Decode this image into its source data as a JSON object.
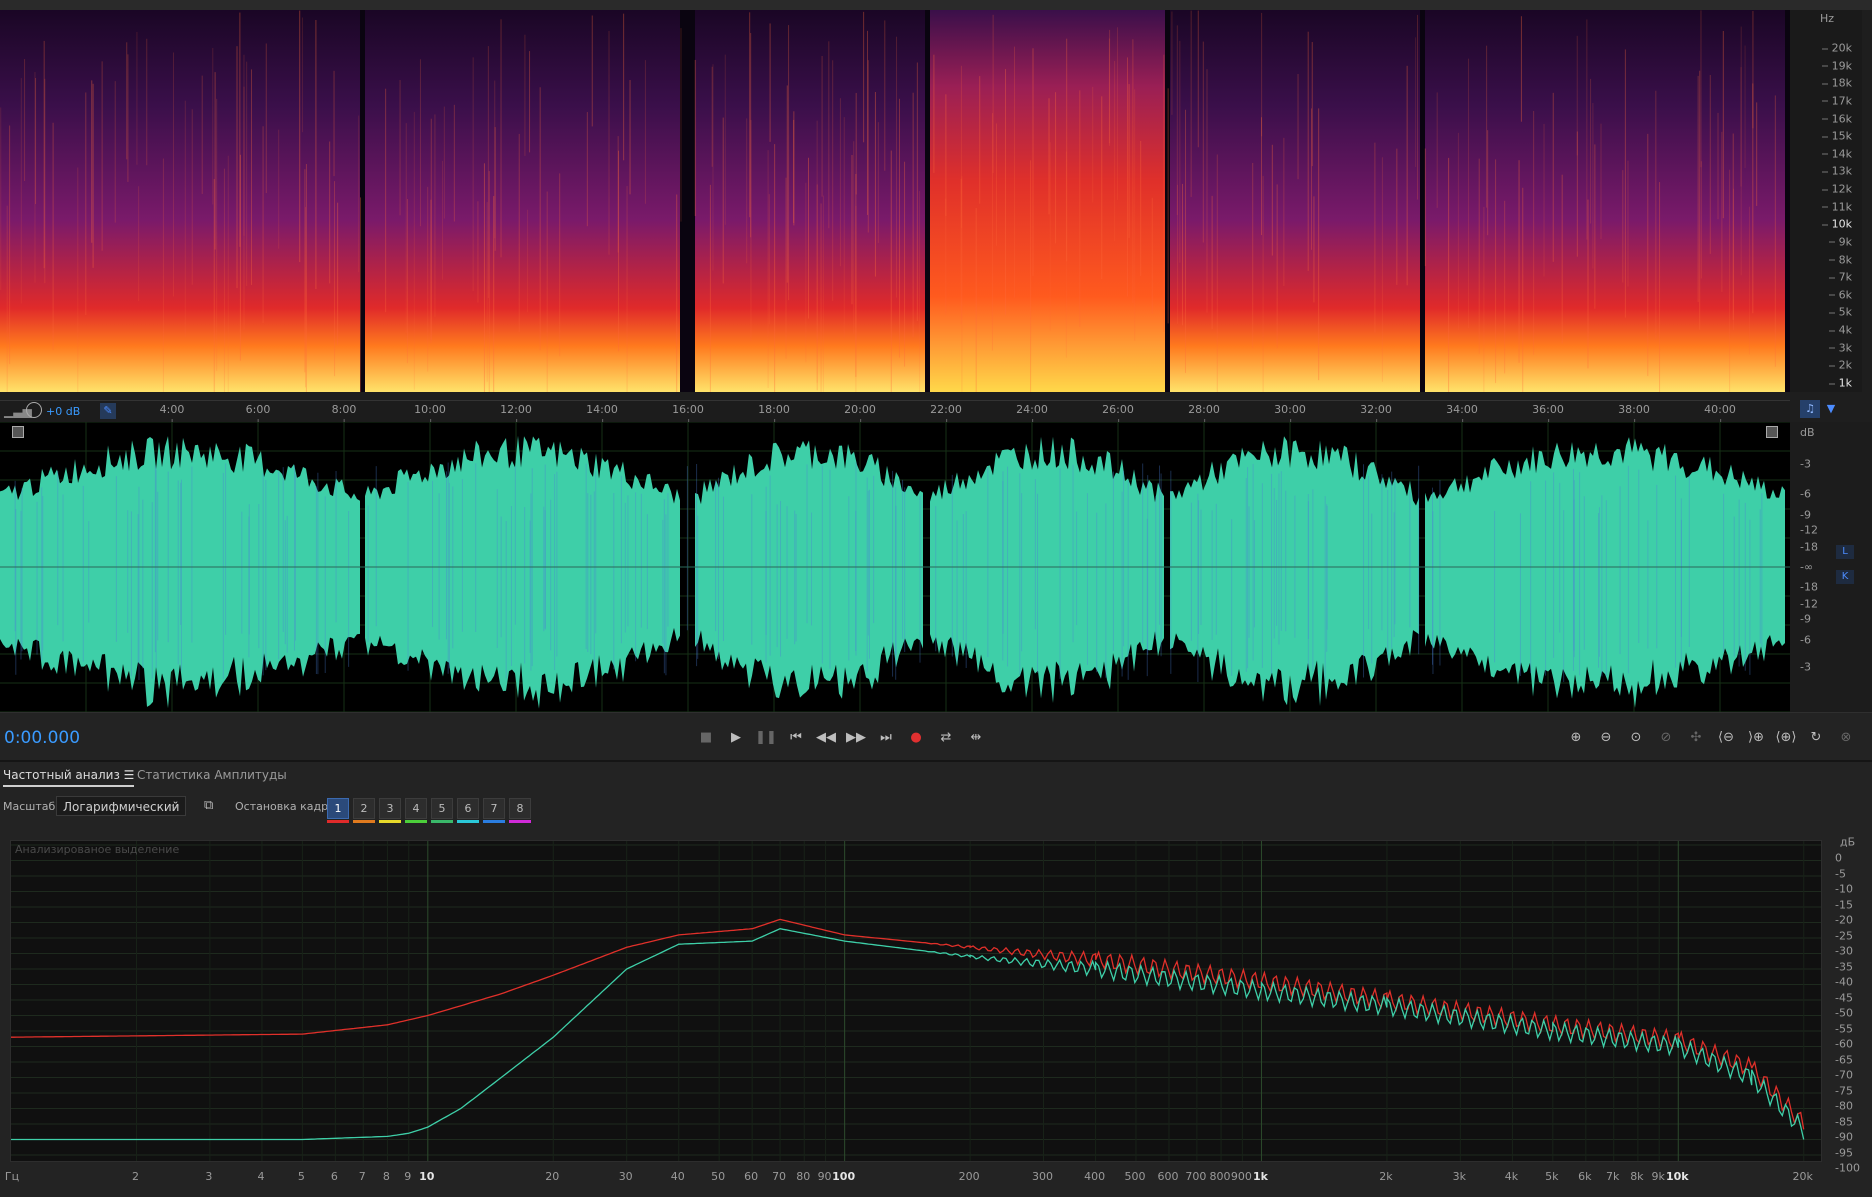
{
  "spectrogram": {
    "unit": "Hz",
    "freq_labels": [
      "20k",
      "19k",
      "18k",
      "17k",
      "16k",
      "15k",
      "14k",
      "13k",
      "12k",
      "11k",
      "10k",
      "9k",
      "8k",
      "7k",
      "6k",
      "5k",
      "4k",
      "3k",
      "2k",
      "1k"
    ]
  },
  "ruler": {
    "gain_label": "+0 dB",
    "time_labels": [
      "4:00",
      "6:00",
      "8:00",
      "10:00",
      "12:00",
      "14:00",
      "16:00",
      "18:00",
      "20:00",
      "22:00",
      "24:00",
      "26:00",
      "28:00",
      "30:00",
      "32:00",
      "34:00",
      "36:00",
      "38:00",
      "40:00"
    ]
  },
  "waveform": {
    "unit": "dB",
    "db_labels": [
      "-3",
      "-6",
      "-9",
      "-12",
      "-18",
      "-∞",
      "-18",
      "-12",
      "-9",
      "-6",
      "-3"
    ],
    "channel_left": "L",
    "channel_right": "K",
    "colors": {
      "left": "#3ecfa8",
      "right": "#4a7fd8"
    }
  },
  "transport": {
    "timecode": "0:00.000",
    "icons": [
      "stop-icon",
      "play-icon",
      "pause-icon",
      "go-to-start-icon",
      "rewind-icon",
      "fast-forward-icon",
      "go-to-end-icon",
      "record-icon",
      "loop-icon",
      "skip-selection-icon"
    ]
  },
  "panel": {
    "tab_frequency": "Частотный анализ",
    "tab_amplitude": "Статистика Амплитуды",
    "scale_label": "Масштаб:",
    "scale_value": "Логарифмический",
    "freeze_label": "Остановка кадра:",
    "frames": [
      "1",
      "2",
      "3",
      "4",
      "5",
      "6",
      "7",
      "8"
    ],
    "frame_colors": [
      "#e02a2a",
      "#e07a1e",
      "#e6d92a",
      "#4ccf3a",
      "#3ab86a",
      "#2ac8d8",
      "#2a7de0",
      "#d02ad8"
    ],
    "overlay_label": "Анализированое выделение"
  },
  "chart_data": {
    "type": "line",
    "x_scale": "log",
    "y_unit": "дБ",
    "x_unit": "Гц",
    "xlim": [
      1,
      22000
    ],
    "ylim": [
      -100,
      0
    ],
    "x_tick_labels": [
      "2",
      "3",
      "4",
      "5",
      "6",
      "7",
      "8",
      "9",
      "10",
      "20",
      "30",
      "40",
      "50",
      "60",
      "70",
      "80",
      "90",
      "100",
      "200",
      "300",
      "400",
      "500",
      "600",
      "700",
      "800",
      "900",
      "1k",
      "2k",
      "3k",
      "4k",
      "5k",
      "6k",
      "7k",
      "8k",
      "9k",
      "10k",
      "20k"
    ],
    "y_tick_labels": [
      "0",
      "-5",
      "-10",
      "-15",
      "-20",
      "-25",
      "-30",
      "-35",
      "-40",
      "-45",
      "-50",
      "-55",
      "-60",
      "-65",
      "-70",
      "-75",
      "-80",
      "-85",
      "-90",
      "-95",
      "-100"
    ],
    "series": [
      {
        "color": "#e0302a",
        "x": [
          1,
          5,
          8,
          10,
          15,
          20,
          30,
          40,
          60,
          70,
          100,
          200,
          400,
          1000,
          2000,
          5000,
          10000,
          15000,
          20000
        ],
        "y": [
          -62,
          -61,
          -58,
          -55,
          -48,
          -42,
          -33,
          -29,
          -27,
          -24,
          -29,
          -33,
          -37,
          -44,
          -50,
          -58,
          -63,
          -72,
          -90
        ]
      },
      {
        "color": "#3ecfa8",
        "x": [
          1,
          5,
          8,
          9,
          10,
          12,
          15,
          20,
          30,
          40,
          60,
          70,
          100,
          200,
          400,
          1000,
          2000,
          5000,
          10000,
          15000,
          20000
        ],
        "y": [
          -95,
          -95,
          -94,
          -93,
          -91,
          -85,
          -75,
          -62,
          -40,
          -32,
          -31,
          -27,
          -31,
          -36,
          -40,
          -47,
          -52,
          -60,
          -65,
          -75,
          -92
        ]
      }
    ]
  }
}
